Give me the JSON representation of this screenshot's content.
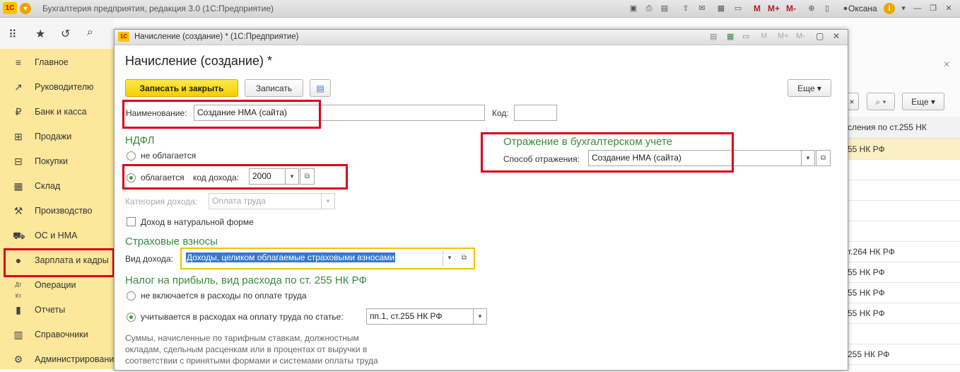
{
  "app": {
    "title": "Бухгалтерия предприятия, редакция 3.0  (1С:Предприятие)",
    "logo": "1С",
    "user": "Оксана",
    "m_buttons": [
      "M",
      "M+",
      "M-"
    ]
  },
  "sidebar": {
    "items": [
      {
        "label": "Главное",
        "icon": "menu-icon"
      },
      {
        "label": "Руководителю",
        "icon": "trend-icon"
      },
      {
        "label": "Банк и касса",
        "icon": "ruble-icon"
      },
      {
        "label": "Продажи",
        "icon": "cart-icon"
      },
      {
        "label": "Покупки",
        "icon": "basket-icon"
      },
      {
        "label": "Склад",
        "icon": "warehouse-icon"
      },
      {
        "label": "Производство",
        "icon": "factory-icon"
      },
      {
        "label": "ОС и НМА",
        "icon": "truck-icon"
      },
      {
        "label": "Зарплата и кадры",
        "icon": "person-icon"
      },
      {
        "label": "Операции",
        "icon": "dt-kt-icon"
      },
      {
        "label": "Отчеты",
        "icon": "bar-chart-icon"
      },
      {
        "label": "Справочники",
        "icon": "book-icon"
      },
      {
        "label": "Администрирование",
        "icon": "gear-icon"
      }
    ]
  },
  "background_list": {
    "more_label": "Еще",
    "header": "сления по ст.255 НК",
    "rows": [
      "55 НК РФ",
      "",
      "",
      "",
      "",
      "т.264 НК РФ",
      "55 НК РФ",
      "55 НК РФ",
      "55 НК РФ",
      "",
      "255 НК РФ"
    ]
  },
  "dialog": {
    "window_title": "Начисление (создание) * (1С:Предприятие)",
    "form_title": "Начисление (создание) *",
    "buttons": {
      "save_close": "Записать и закрыть",
      "save": "Записать",
      "more": "Еще"
    },
    "name": {
      "label": "Наименование:",
      "value": "Создание НМА (сайта)"
    },
    "code": {
      "label": "Код:",
      "value": ""
    },
    "ndfl": {
      "section": "НДФЛ",
      "not_taxed": "не облагается",
      "taxed": "облагается",
      "income_code_label": "код дохода:",
      "income_code_value": "2000",
      "category_label": "Категория дохода:",
      "category_value": "Оплата труда",
      "in_kind": "Доход в натуральной форме"
    },
    "accounting": {
      "section": "Отражение в бухгалтерском учете",
      "method_label": "Способ отражения:",
      "method_value": "Создание НМА (сайта)"
    },
    "insurance": {
      "section": "Страховые взносы",
      "income_type_label": "Вид дохода:",
      "income_type_value": "Доходы, целиком облагаемые страховыми взносами"
    },
    "profit_tax": {
      "section": "Налог на прибыль, вид расхода по ст. 255 НК РФ",
      "not_included": "не включается в расходы по оплате труда",
      "included": "учитывается в расходах на оплату труда по статье:",
      "article_value": "пп.1, ст.255 НК РФ",
      "note": [
        "Суммы, начисленные по тарифным ставкам, должностным",
        "окладам, сдельным расценкам или в процентах от выручки в",
        "соответствии с принятыми формами и системами оплаты труда"
      ]
    }
  }
}
